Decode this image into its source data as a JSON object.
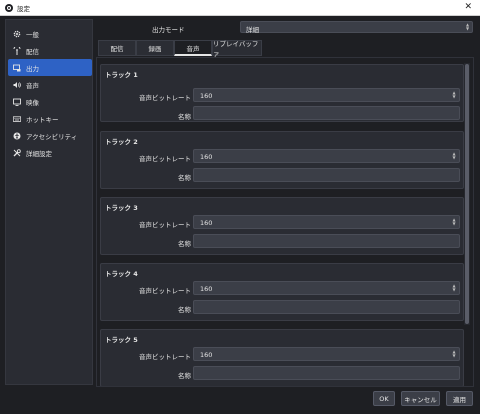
{
  "window": {
    "title": "設定",
    "close_glyph": "✕"
  },
  "sidebar": {
    "items": [
      {
        "label": "一般",
        "icon": "gear-icon"
      },
      {
        "label": "配信",
        "icon": "broadcast-icon"
      },
      {
        "label": "出力",
        "icon": "output-icon",
        "active": true
      },
      {
        "label": "音声",
        "icon": "speaker-icon"
      },
      {
        "label": "映像",
        "icon": "monitor-icon"
      },
      {
        "label": "ホットキー",
        "icon": "keyboard-icon"
      },
      {
        "label": "アクセシビリティ",
        "icon": "accessibility-icon"
      },
      {
        "label": "詳細設定",
        "icon": "tools-icon"
      }
    ]
  },
  "output_mode": {
    "label": "出力モード",
    "value": "詳細"
  },
  "tabs": [
    {
      "label": "配信"
    },
    {
      "label": "録画"
    },
    {
      "label": "音声",
      "active": true
    },
    {
      "label": "リプレイバッファ"
    }
  ],
  "tracks": [
    {
      "title": "トラック 1",
      "bitrate_label": "音声ビットレート",
      "bitrate": "160",
      "name_label": "名称",
      "name": ""
    },
    {
      "title": "トラック 2",
      "bitrate_label": "音声ビットレート",
      "bitrate": "160",
      "name_label": "名称",
      "name": ""
    },
    {
      "title": "トラック 3",
      "bitrate_label": "音声ビットレート",
      "bitrate": "160",
      "name_label": "名称",
      "name": ""
    },
    {
      "title": "トラック 4",
      "bitrate_label": "音声ビットレート",
      "bitrate": "160",
      "name_label": "名称",
      "name": ""
    },
    {
      "title": "トラック 5",
      "bitrate_label": "音声ビットレート",
      "bitrate": "160",
      "name_label": "名称",
      "name": ""
    }
  ],
  "buttons": {
    "ok": "OK",
    "cancel": "キャンセル",
    "apply": "適用"
  },
  "colors": {
    "accent": "#2e62c5",
    "background": "#1e1f23",
    "panel": "#2a2c33",
    "field": "#3b3e47"
  }
}
